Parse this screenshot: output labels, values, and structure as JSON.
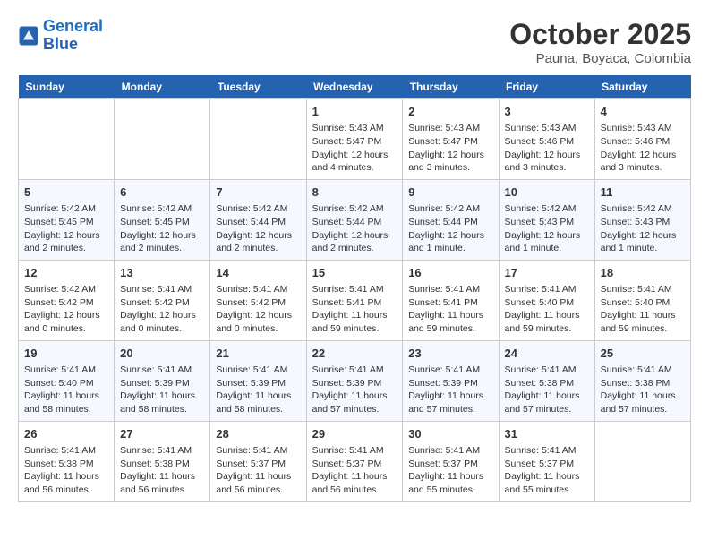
{
  "header": {
    "logo_line1": "General",
    "logo_line2": "Blue",
    "title": "October 2025",
    "subtitle": "Pauna, Boyaca, Colombia"
  },
  "weekdays": [
    "Sunday",
    "Monday",
    "Tuesday",
    "Wednesday",
    "Thursday",
    "Friday",
    "Saturday"
  ],
  "weeks": [
    [
      {
        "day": "",
        "info": ""
      },
      {
        "day": "",
        "info": ""
      },
      {
        "day": "",
        "info": ""
      },
      {
        "day": "1",
        "info": "Sunrise: 5:43 AM\nSunset: 5:47 PM\nDaylight: 12 hours and 4 minutes."
      },
      {
        "day": "2",
        "info": "Sunrise: 5:43 AM\nSunset: 5:47 PM\nDaylight: 12 hours and 3 minutes."
      },
      {
        "day": "3",
        "info": "Sunrise: 5:43 AM\nSunset: 5:46 PM\nDaylight: 12 hours and 3 minutes."
      },
      {
        "day": "4",
        "info": "Sunrise: 5:43 AM\nSunset: 5:46 PM\nDaylight: 12 hours and 3 minutes."
      }
    ],
    [
      {
        "day": "5",
        "info": "Sunrise: 5:42 AM\nSunset: 5:45 PM\nDaylight: 12 hours and 2 minutes."
      },
      {
        "day": "6",
        "info": "Sunrise: 5:42 AM\nSunset: 5:45 PM\nDaylight: 12 hours and 2 minutes."
      },
      {
        "day": "7",
        "info": "Sunrise: 5:42 AM\nSunset: 5:44 PM\nDaylight: 12 hours and 2 minutes."
      },
      {
        "day": "8",
        "info": "Sunrise: 5:42 AM\nSunset: 5:44 PM\nDaylight: 12 hours and 2 minutes."
      },
      {
        "day": "9",
        "info": "Sunrise: 5:42 AM\nSunset: 5:44 PM\nDaylight: 12 hours and 1 minute."
      },
      {
        "day": "10",
        "info": "Sunrise: 5:42 AM\nSunset: 5:43 PM\nDaylight: 12 hours and 1 minute."
      },
      {
        "day": "11",
        "info": "Sunrise: 5:42 AM\nSunset: 5:43 PM\nDaylight: 12 hours and 1 minute."
      }
    ],
    [
      {
        "day": "12",
        "info": "Sunrise: 5:42 AM\nSunset: 5:42 PM\nDaylight: 12 hours and 0 minutes."
      },
      {
        "day": "13",
        "info": "Sunrise: 5:41 AM\nSunset: 5:42 PM\nDaylight: 12 hours and 0 minutes."
      },
      {
        "day": "14",
        "info": "Sunrise: 5:41 AM\nSunset: 5:42 PM\nDaylight: 12 hours and 0 minutes."
      },
      {
        "day": "15",
        "info": "Sunrise: 5:41 AM\nSunset: 5:41 PM\nDaylight: 11 hours and 59 minutes."
      },
      {
        "day": "16",
        "info": "Sunrise: 5:41 AM\nSunset: 5:41 PM\nDaylight: 11 hours and 59 minutes."
      },
      {
        "day": "17",
        "info": "Sunrise: 5:41 AM\nSunset: 5:40 PM\nDaylight: 11 hours and 59 minutes."
      },
      {
        "day": "18",
        "info": "Sunrise: 5:41 AM\nSunset: 5:40 PM\nDaylight: 11 hours and 59 minutes."
      }
    ],
    [
      {
        "day": "19",
        "info": "Sunrise: 5:41 AM\nSunset: 5:40 PM\nDaylight: 11 hours and 58 minutes."
      },
      {
        "day": "20",
        "info": "Sunrise: 5:41 AM\nSunset: 5:39 PM\nDaylight: 11 hours and 58 minutes."
      },
      {
        "day": "21",
        "info": "Sunrise: 5:41 AM\nSunset: 5:39 PM\nDaylight: 11 hours and 58 minutes."
      },
      {
        "day": "22",
        "info": "Sunrise: 5:41 AM\nSunset: 5:39 PM\nDaylight: 11 hours and 57 minutes."
      },
      {
        "day": "23",
        "info": "Sunrise: 5:41 AM\nSunset: 5:39 PM\nDaylight: 11 hours and 57 minutes."
      },
      {
        "day": "24",
        "info": "Sunrise: 5:41 AM\nSunset: 5:38 PM\nDaylight: 11 hours and 57 minutes."
      },
      {
        "day": "25",
        "info": "Sunrise: 5:41 AM\nSunset: 5:38 PM\nDaylight: 11 hours and 57 minutes."
      }
    ],
    [
      {
        "day": "26",
        "info": "Sunrise: 5:41 AM\nSunset: 5:38 PM\nDaylight: 11 hours and 56 minutes."
      },
      {
        "day": "27",
        "info": "Sunrise: 5:41 AM\nSunset: 5:38 PM\nDaylight: 11 hours and 56 minutes."
      },
      {
        "day": "28",
        "info": "Sunrise: 5:41 AM\nSunset: 5:37 PM\nDaylight: 11 hours and 56 minutes."
      },
      {
        "day": "29",
        "info": "Sunrise: 5:41 AM\nSunset: 5:37 PM\nDaylight: 11 hours and 56 minutes."
      },
      {
        "day": "30",
        "info": "Sunrise: 5:41 AM\nSunset: 5:37 PM\nDaylight: 11 hours and 55 minutes."
      },
      {
        "day": "31",
        "info": "Sunrise: 5:41 AM\nSunset: 5:37 PM\nDaylight: 11 hours and 55 minutes."
      },
      {
        "day": "",
        "info": ""
      }
    ]
  ]
}
